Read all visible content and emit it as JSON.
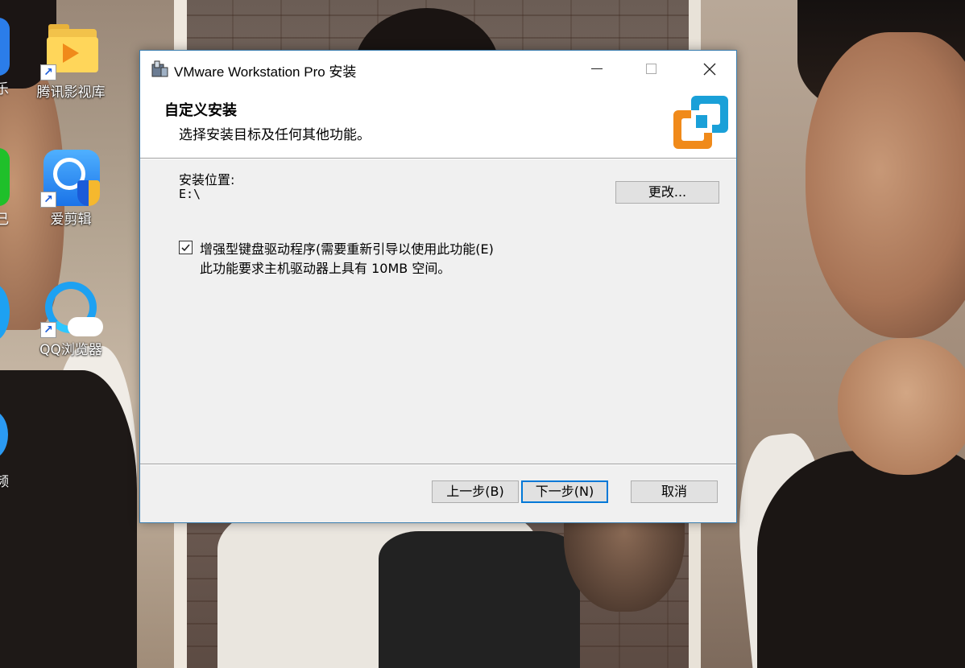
{
  "desktop": {
    "icons": [
      {
        "label": "腾讯影视库"
      },
      {
        "label": "爱剪辑"
      },
      {
        "label": "QQ浏览器"
      }
    ],
    "edge_labels": [
      "乐",
      "己",
      "频"
    ]
  },
  "window": {
    "title": "VMware Workstation Pro 安装",
    "heading": "自定义安装",
    "subheading": "选择安装目标及任何其他功能。",
    "install_location_label": "安装位置:",
    "install_location_value": "E:\\",
    "change_button": "更改...",
    "feature": {
      "checked": true,
      "label": "增强型键盘驱动程序(需要重新引导以使用此功能(E)",
      "description": "此功能要求主机驱动器上具有 10MB 空间。"
    },
    "buttons": {
      "back": "上一步(B)",
      "next": "下一步(N)",
      "cancel": "取消"
    },
    "accent_color": "#0078d7",
    "logo_colors": {
      "orange": "#f08a1a",
      "blue": "#1aa0d8"
    }
  }
}
